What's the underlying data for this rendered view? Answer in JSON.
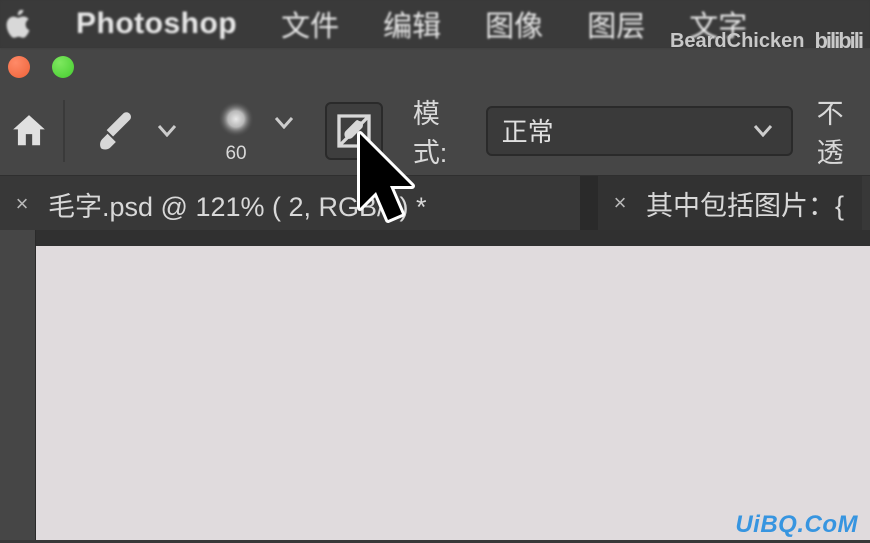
{
  "menubar": {
    "app_title": "Photoshop",
    "items": [
      "文件",
      "编辑",
      "图像",
      "图层",
      "文字"
    ]
  },
  "options_bar": {
    "brush_size": "60",
    "mode_label": "模式:",
    "mode_value": "正常",
    "opacity_label": "不透"
  },
  "tabs": [
    {
      "title": "毛字.psd @ 121% (       2, RGB/8) *",
      "active": true
    },
    {
      "title": "其中包括图片：{",
      "active": false
    }
  ],
  "icons": {
    "apple": "apple-icon",
    "home": "home-icon",
    "brush_tool": "brush-tool-icon",
    "chevron_down": "chevron-down-icon",
    "brush_dab": "soft-brush-dab-icon",
    "brush_panel": "brush-panel-icon",
    "close_x": "×"
  },
  "watermarks": {
    "top_right_name": "BeardChicken",
    "top_right_logo": "bilibili",
    "bottom_right": "UiBQ.CoM"
  }
}
